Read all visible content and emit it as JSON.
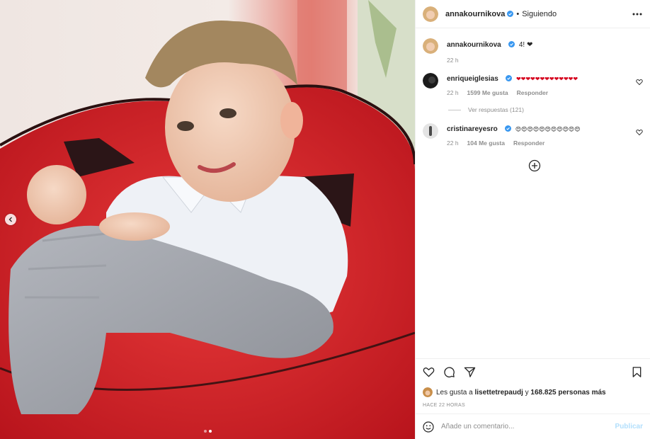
{
  "post": {
    "author": "annakournikova",
    "follow_status": "Siguiendo",
    "separator": "•",
    "slide_count": 2,
    "active_slide": 2
  },
  "caption": {
    "user": "annakournikova",
    "text": "4! ❤",
    "time": "22 h"
  },
  "comments": [
    {
      "user": "enriqueiglesias",
      "text": "❤❤❤❤❤❤❤❤❤❤❤❤❤",
      "time": "22 h",
      "likes": "1599 Me gusta",
      "reply": "Responder",
      "view_replies": "Ver respuestas (121)"
    },
    {
      "user": "cristinareyesro",
      "text": "😍😍😍😍😍😍😍😍😍😍😍",
      "time": "22 h",
      "likes": "104 Me gusta",
      "reply": "Responder"
    }
  ],
  "likes": {
    "prefix": "Les gusta a",
    "user": "lisettetrepaudj",
    "connector": "y",
    "others": "168.825 personas más"
  },
  "timestamp": "HACE 22 HORAS",
  "composer": {
    "placeholder": "Añade un comentario...",
    "publish": "Publicar"
  },
  "colors": {
    "verified": "#3897f0",
    "heart": "#d5001c",
    "chair_red": "#d8232a",
    "link_disabled": "#b2dffc"
  },
  "icons": [
    "chevron-left-icon",
    "verified-icon",
    "more-icon",
    "heart-icon",
    "comment-icon",
    "share-icon",
    "bookmark-icon",
    "add-circle-icon",
    "emoji-icon"
  ]
}
